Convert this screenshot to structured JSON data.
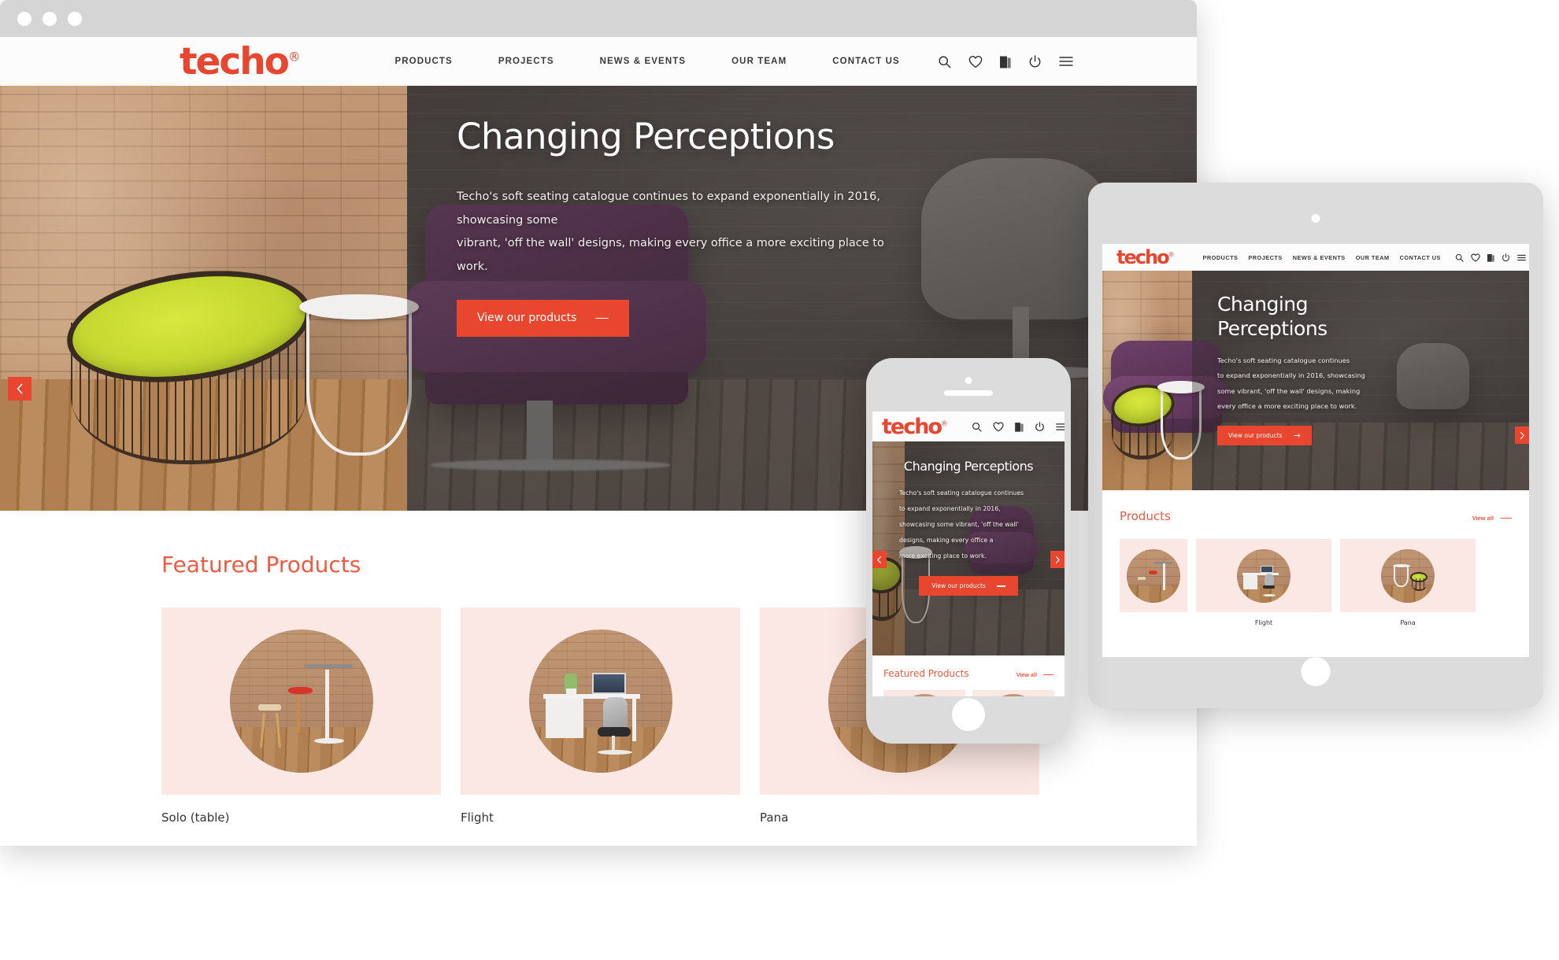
{
  "brand": {
    "name": "techo",
    "registered_mark": "®",
    "accent_color": "#e8462f",
    "title_color": "#ef5a41",
    "card_bg_color": "#fbe7e3"
  },
  "browser_chrome": {
    "traffic_lights": [
      "window-close",
      "window-minimize",
      "window-zoom"
    ]
  },
  "desktop": {
    "nav": {
      "items": [
        {
          "label": "PRODUCTS"
        },
        {
          "label": "PROJECTS"
        },
        {
          "label": "NEWS & EVENTS"
        },
        {
          "label": "OUR TEAM"
        },
        {
          "label": "CONTACT US"
        }
      ],
      "icons": [
        {
          "name": "search-icon"
        },
        {
          "name": "heart-icon"
        },
        {
          "name": "brochure-icon"
        },
        {
          "name": "power-icon"
        },
        {
          "name": "hamburger-menu-icon"
        }
      ]
    },
    "hero": {
      "title": "Changing Perceptions",
      "body_line1": "Techo's soft seating catalogue continues to expand exponentially in 2016, showcasing some",
      "body_line2": "vibrant, 'off the wall' designs, making every office a more exciting place to work.",
      "cta_label": "View our products",
      "prev_arrow": "‹",
      "next_arrow": "›"
    },
    "featured": {
      "heading": "Featured Products",
      "products": [
        {
          "label": "Solo (table)"
        },
        {
          "label": "Flight"
        },
        {
          "label": "Pana"
        }
      ]
    }
  },
  "tablet": {
    "nav": {
      "items": [
        {
          "label": "PRODUCTS"
        },
        {
          "label": "PROJECTS"
        },
        {
          "label": "NEWS & EVENTS"
        },
        {
          "label": "OUR TEAM"
        },
        {
          "label": "CONTACT US"
        }
      ],
      "icons": [
        {
          "name": "search-icon"
        },
        {
          "name": "heart-icon"
        },
        {
          "name": "brochure-icon"
        },
        {
          "name": "power-icon"
        },
        {
          "name": "hamburger-menu-icon"
        }
      ]
    },
    "hero": {
      "title_line1": "Changing",
      "title_line2": "Perceptions",
      "body_line1": "Techo's soft seating catalogue continues",
      "body_line2": "to expand exponentially in 2016, showcasing",
      "body_line3": "some vibrant, 'off the wall' designs, making",
      "body_line4": "every office a more exciting place to work.",
      "cta_label": "View our products",
      "next_arrow": "›"
    },
    "featured": {
      "heading": "Products",
      "view_all_label": "View all",
      "products": [
        {
          "label": ""
        },
        {
          "label": "Flight"
        },
        {
          "label": "Pana"
        }
      ]
    }
  },
  "phone": {
    "nav": {
      "icons": [
        {
          "name": "search-icon"
        },
        {
          "name": "heart-icon"
        },
        {
          "name": "brochure-icon"
        },
        {
          "name": "power-icon"
        },
        {
          "name": "hamburger-menu-icon"
        }
      ]
    },
    "hero": {
      "title": "Changing Perceptions",
      "body_line1": "Techo's soft seating catalogue continues",
      "body_line2": "to expand exponentially in 2016,",
      "body_line3": "showcasing some vibrant, 'off the wall'",
      "body_line4": "designs, making every office a",
      "body_line5": "more exciting place to work.",
      "cta_label": "View our products",
      "prev_arrow": "‹",
      "next_arrow": "›"
    },
    "featured": {
      "heading": "Featured Products",
      "view_all_label": "View all"
    }
  }
}
